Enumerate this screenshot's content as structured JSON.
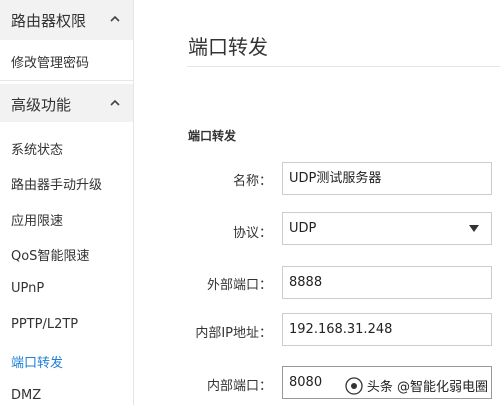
{
  "sidebar": {
    "sections": [
      {
        "title": "路由器权限",
        "items": [
          "修改管理密码"
        ]
      },
      {
        "title": "高级功能",
        "items": [
          "系统状态",
          "路由器手动升级",
          "应用限速",
          "QoS智能限速",
          "UPnP",
          "PPTP/L2TP",
          "端口转发",
          "DMZ"
        ]
      }
    ],
    "active_item": "端口转发"
  },
  "main": {
    "page_title": "端口转发",
    "section_title": "端口转发",
    "form": {
      "name_label": "名称：",
      "name_value": "UDP测试服务器",
      "protocol_label": "协议：",
      "protocol_value": "UDP",
      "external_port_label": "外部端口：",
      "external_port_value": "8888",
      "internal_ip_label": "内部IP地址：",
      "internal_ip_value": "192.168.31.248",
      "internal_port_label": "内部端口：",
      "internal_port_value": "8080"
    }
  },
  "watermark": "头条 @智能化弱电圈",
  "colors": {
    "accent": "#1e7fd6",
    "section_bg": "#f2f2f2",
    "border": "#cccccc"
  }
}
